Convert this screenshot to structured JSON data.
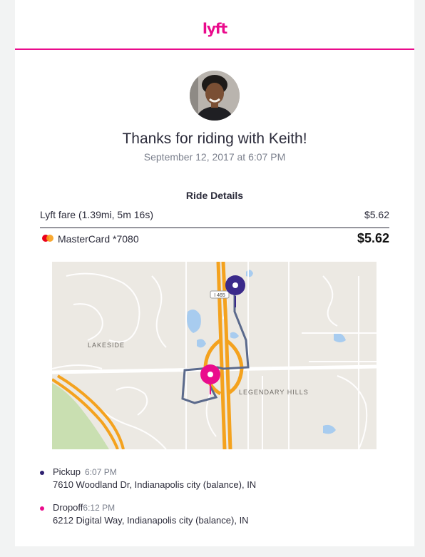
{
  "brand": {
    "logo_text": "lyft",
    "accent_color": "#ea0b8c"
  },
  "driver": {
    "avatar": "driver-avatar-photo"
  },
  "header": {
    "title": "Thanks for riding with Keith!",
    "date": "September 12, 2017 at 6:07 PM"
  },
  "ride_details": {
    "title": "Ride Details",
    "fare_label": "Lyft fare (1.39mi, 5m 16s)",
    "fare_amount": "$5.62",
    "payment_method": "MasterCard *7080",
    "payment_icon": "mastercard-icon",
    "total": "$5.62"
  },
  "map": {
    "highway_label": "I 465",
    "area_labels": [
      "LAKESIDE",
      "LEGENDARY HILLS"
    ],
    "pickup_marker_color": "#3b2a8a",
    "dropoff_marker_color": "#ea0b8c"
  },
  "stops": {
    "pickup": {
      "label": "Pickup",
      "time": "6:07 PM",
      "address": "7610 Woodland Dr, Indianapolis city (balance), IN",
      "color": "#2e2170"
    },
    "dropoff": {
      "label": "Dropoff",
      "time": "6:12 PM",
      "address": "6212 Digital Way, Indianapolis city (balance), IN",
      "color": "#ea0b8c"
    }
  }
}
